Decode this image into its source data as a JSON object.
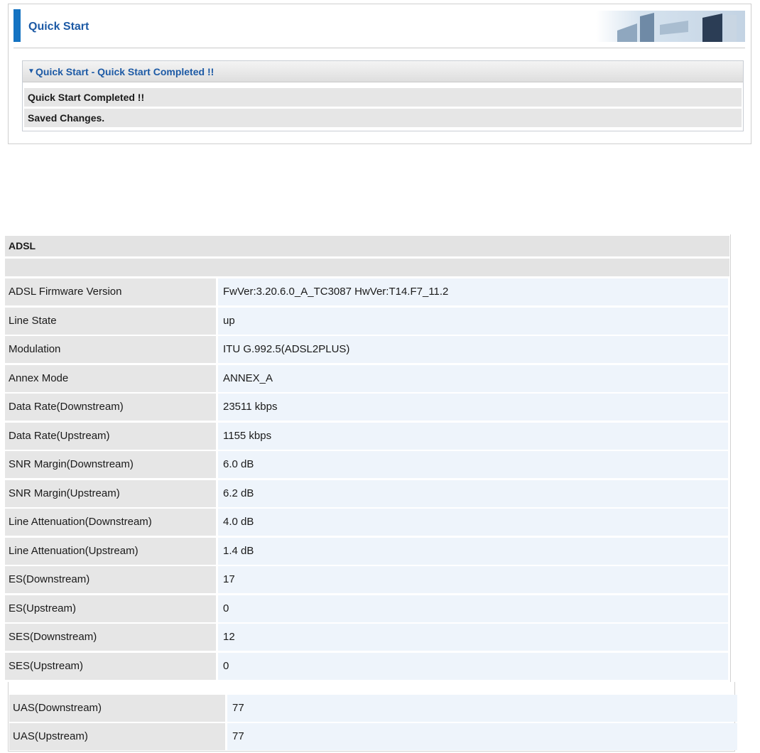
{
  "quick_start": {
    "title": "Quick Start",
    "box_title": "Quick Start - Quick Start Completed !!",
    "rows": [
      "Quick Start Completed !!",
      "Saved Changes."
    ],
    "accent_color": "#1473c2"
  },
  "adsl": {
    "title": "ADSL",
    "rows": [
      {
        "label": "ADSL Firmware Version",
        "value": "FwVer:3.20.6.0_A_TC3087 HwVer:T14.F7_11.2"
      },
      {
        "label": "Line State",
        "value": "up"
      },
      {
        "label": "Modulation",
        "value": "ITU G.992.5(ADSL2PLUS)"
      },
      {
        "label": "Annex Mode",
        "value": "ANNEX_A"
      },
      {
        "label": "Data Rate(Downstream)",
        "value": "23511 kbps"
      },
      {
        "label": "Data Rate(Upstream)",
        "value": "1155 kbps"
      },
      {
        "label": "SNR Margin(Downstream)",
        "value": "6.0 dB"
      },
      {
        "label": "SNR Margin(Upstream)",
        "value": "6.2 dB"
      },
      {
        "label": "Line Attenuation(Downstream)",
        "value": "4.0 dB"
      },
      {
        "label": "Line Attenuation(Upstream)",
        "value": "1.4 dB"
      },
      {
        "label": "ES(Downstream)",
        "value": "17"
      },
      {
        "label": "ES(Upstream)",
        "value": "0"
      },
      {
        "label": "SES(Downstream)",
        "value": "12"
      },
      {
        "label": "SES(Upstream)",
        "value": "0"
      },
      {
        "label": "UAS(Downstream)",
        "value": "77"
      },
      {
        "label": "UAS(Upstream)",
        "value": "77"
      }
    ]
  }
}
